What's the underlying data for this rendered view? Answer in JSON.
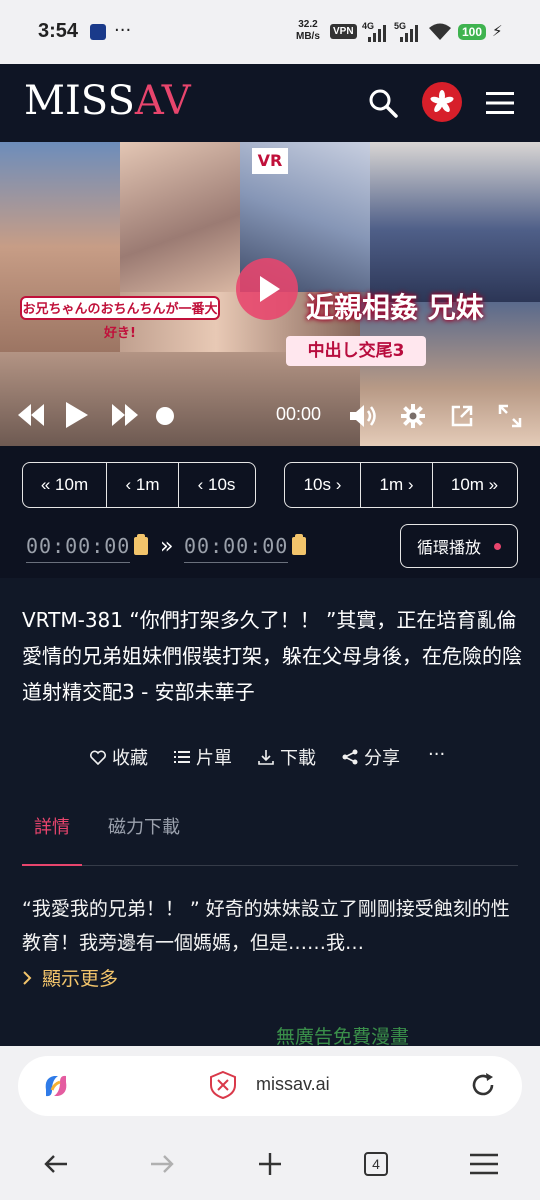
{
  "status_bar": {
    "time": "3:54",
    "speed_value": "32.2",
    "speed_unit": "MB/s",
    "vpn": "VPN",
    "net1": "4G",
    "net2": "5G",
    "battery": "100"
  },
  "header": {
    "logo_part1": "MISS",
    "logo_part2": "AV",
    "accent_color": "#e8456d"
  },
  "video": {
    "overlay_tag": "VR",
    "banner_left": "お兄ちゃんのおちんちんが一番大好き!",
    "banner_right": "近親相姦 兄妹",
    "banner_sub": "中出し交尾3",
    "current_time": "00:00"
  },
  "seek": {
    "back": [
      "10m",
      "1m",
      "10s"
    ],
    "forward": [
      "10s",
      "1m",
      "10m"
    ]
  },
  "ab_loop": {
    "start": "00:00:00",
    "end": "00:00:00",
    "loop_label": "循環播放"
  },
  "title": "VRTM-381 “你們打架多久了！！ ”其實，正在培育亂倫愛情的兄弟姐妹們假裝打架，躲在父母身後，在危險的陰道射精交配3 - 安部未華子",
  "actions": {
    "favorite": "收藏",
    "playlist": "片單",
    "download": "下載",
    "share": "分享",
    "more": "···"
  },
  "tabs": [
    {
      "label": "詳情",
      "active": true
    },
    {
      "label": "磁力下載",
      "active": false
    }
  ],
  "description": "“我愛我的兄弟！！ ” 好奇的妹妹設立了剛剛接受蝕刻的性教育！我旁邊有一個媽媽，但是……我…",
  "show_more": "顯示更多",
  "ad_text": "無廣告免費漫畫",
  "browser": {
    "url": "missav.ai",
    "tab_count": "4"
  }
}
